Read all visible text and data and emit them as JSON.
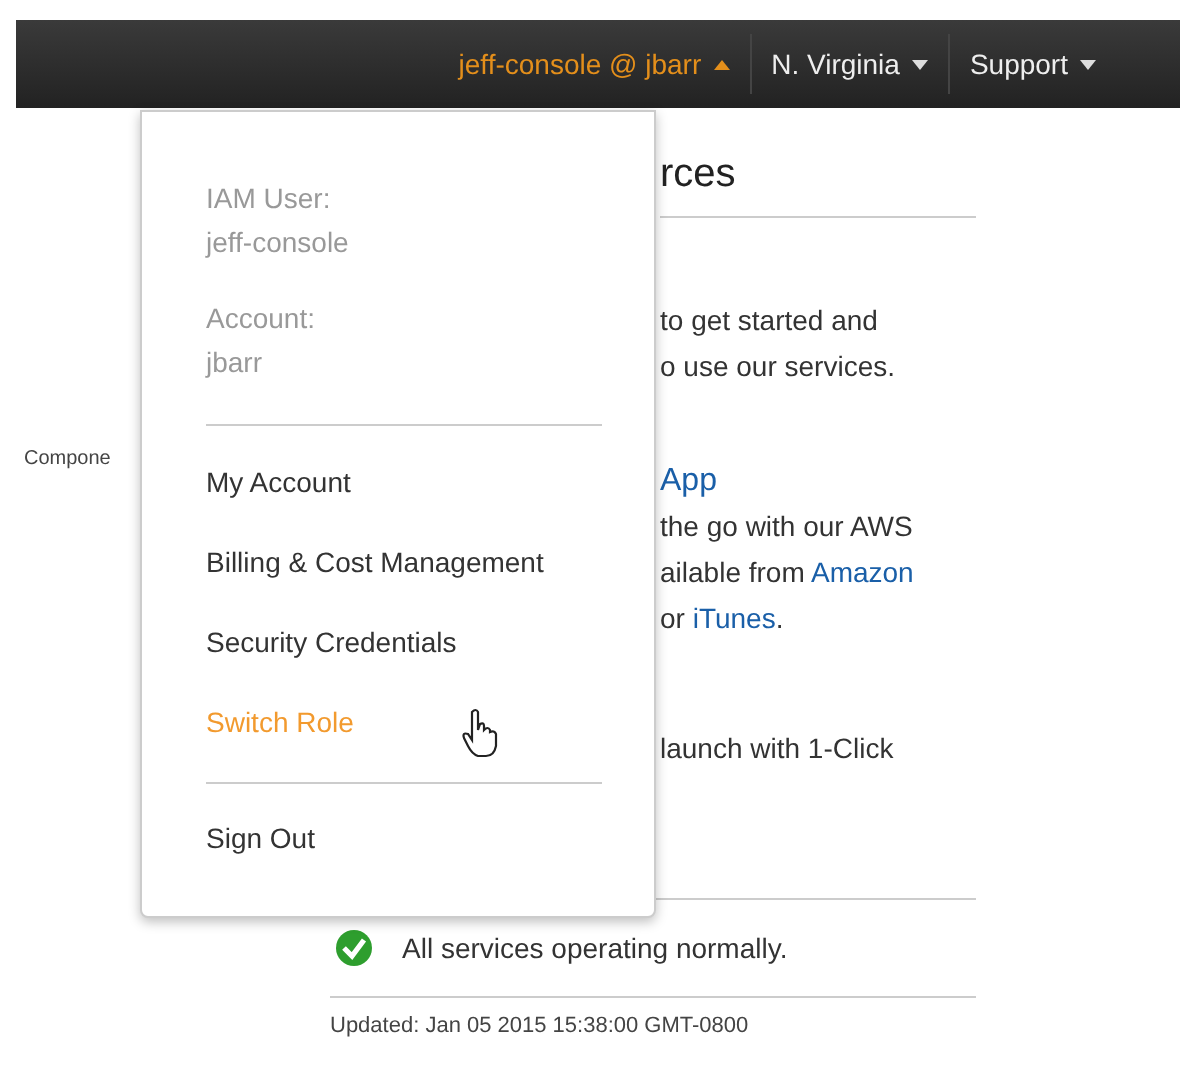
{
  "header": {
    "menus": [
      {
        "label": "jeff-console @ jbarr",
        "kind": "account",
        "expanded": true
      },
      {
        "label": "N. Virginia",
        "kind": "plain",
        "expanded": false
      },
      {
        "label": "Support",
        "kind": "plain",
        "expanded": false
      }
    ]
  },
  "account_menu": {
    "info": [
      {
        "label": "IAM User:",
        "value": "jeff-console"
      },
      {
        "label": "Account:",
        "value": "jbarr"
      }
    ],
    "items": [
      {
        "label": "My Account",
        "selected": false
      },
      {
        "label": "Billing & Cost Management",
        "selected": false
      },
      {
        "label": "Security Credentials",
        "selected": false
      },
      {
        "label": "Switch Role",
        "selected": true
      }
    ],
    "footer_items": [
      {
        "label": "Sign Out",
        "selected": false
      }
    ]
  },
  "page": {
    "side_label": "Compone",
    "heading": "rces",
    "blocks": [
      {
        "kind": "text",
        "lines": [
          [
            {
              "text": "to get started and",
              "kind": "text"
            }
          ],
          [
            {
              "text": "o use our services.",
              "kind": "text"
            }
          ]
        ]
      },
      {
        "kind": "app",
        "title": "App",
        "lines": [
          [
            {
              "text": "the go with our AWS",
              "kind": "text"
            }
          ],
          [
            {
              "text": "ailable from ",
              "kind": "text"
            },
            {
              "text": "Amazon",
              "kind": "link"
            }
          ],
          [
            {
              "text": "or ",
              "kind": "text"
            },
            {
              "text": "iTunes",
              "kind": "link"
            },
            {
              "text": ".",
              "kind": "text"
            }
          ]
        ]
      },
      {
        "kind": "text",
        "lines": [
          [
            {
              "text": "launch with 1-Click",
              "kind": "text"
            }
          ]
        ]
      }
    ],
    "status": {
      "ok": true,
      "text": "All services operating normally.",
      "updated": "Updated: Jan 05 2015 15:38:00 GMT-0800"
    }
  }
}
